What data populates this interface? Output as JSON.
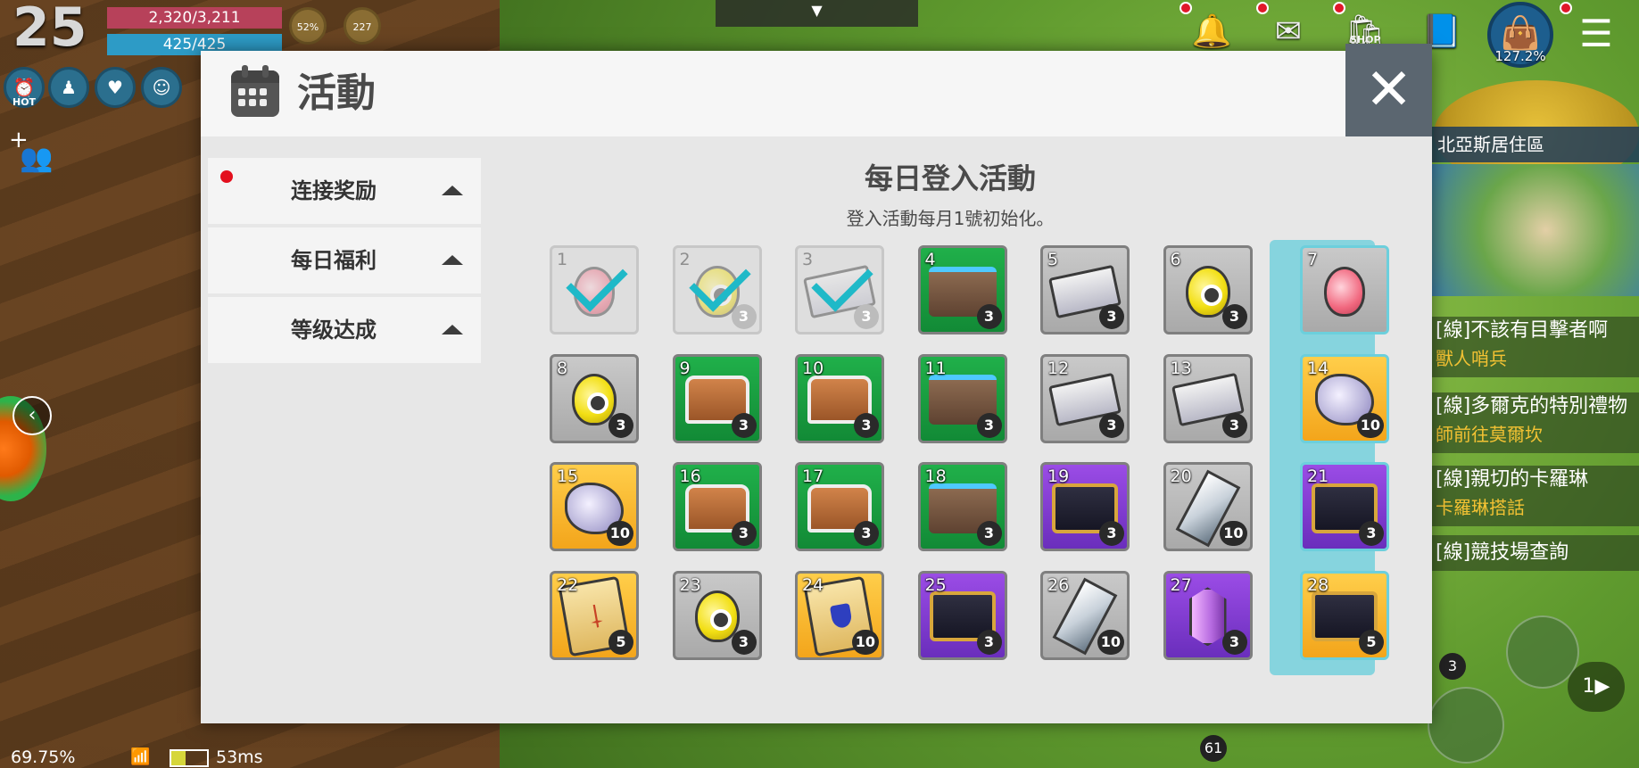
{
  "hud": {
    "level": "25",
    "hp": "2,320/3,211",
    "mp": "425/425",
    "ring_left_pct": "52%",
    "ring_right_val": "227",
    "hot_badge": "HOT",
    "bag_pct": "127.2%",
    "top_icons": [
      "bell-icon",
      "mail-icon",
      "shop-icon",
      "book-icon"
    ],
    "shop_label": "SHOP"
  },
  "status": {
    "battery": "69.75%",
    "ping": "53ms"
  },
  "world": {
    "minimap_label": "北亞斯居住區",
    "quests": [
      {
        "title": "[線]不該有目擊者啊",
        "sub": "獸人哨兵"
      },
      {
        "title": "[線]多爾克的特別禮物",
        "sub": "師前往莫爾坎"
      },
      {
        "title": "[線]親切的卡羅琳",
        "sub": "卡羅琳搭話"
      }
    ],
    "quest_single": "[線]競技場查詢",
    "skill_count_a": "61",
    "skill_count_b": "3",
    "page_next": "1▶"
  },
  "dialog": {
    "title": "活動",
    "close_label": "✕",
    "menu": [
      {
        "label": "连接奖励",
        "has_notification": true
      },
      {
        "label": "每日福利",
        "has_notification": false
      },
      {
        "label": "等级达成",
        "has_notification": false
      }
    ],
    "event_title": "每日登入活動",
    "event_subtitle": "登入活動每月1號初始化。",
    "days": [
      {
        "day": "1",
        "item": "potion-pink",
        "bg": "faded",
        "claimed": true
      },
      {
        "day": "2",
        "item": "potion-yellow",
        "bg": "faded",
        "qty": "3",
        "claimed": true
      },
      {
        "day": "3",
        "item": "ticket",
        "bg": "faded",
        "qty": "3",
        "claimed": true
      },
      {
        "day": "4",
        "item": "chest-green",
        "bg": "green",
        "qty": "3"
      },
      {
        "day": "5",
        "item": "ticket",
        "bg": "gray",
        "qty": "3"
      },
      {
        "day": "6",
        "item": "potion-yellow",
        "bg": "gray",
        "qty": "3"
      },
      {
        "day": "7",
        "item": "potion-pink",
        "bg": "gray",
        "highlight": true
      },
      {
        "day": "8",
        "item": "potion-yellow",
        "bg": "gray",
        "qty": "3"
      },
      {
        "day": "9",
        "item": "chest-wood",
        "bg": "green",
        "qty": "3"
      },
      {
        "day": "10",
        "item": "chest-wood",
        "bg": "green",
        "qty": "3"
      },
      {
        "day": "11",
        "item": "chest-green",
        "bg": "green",
        "qty": "3"
      },
      {
        "day": "12",
        "item": "ticket",
        "bg": "gray",
        "qty": "3"
      },
      {
        "day": "13",
        "item": "ticket",
        "bg": "gray",
        "qty": "3"
      },
      {
        "day": "14",
        "item": "ore",
        "bg": "gold",
        "qty": "10",
        "highlight": true
      },
      {
        "day": "15",
        "item": "ore",
        "bg": "gold",
        "qty": "10"
      },
      {
        "day": "16",
        "item": "chest-wood",
        "bg": "green",
        "qty": "3"
      },
      {
        "day": "17",
        "item": "chest-wood",
        "bg": "green",
        "qty": "3"
      },
      {
        "day": "18",
        "item": "chest-green",
        "bg": "green",
        "qty": "3"
      },
      {
        "day": "19",
        "item": "chest-purple",
        "bg": "purple",
        "qty": "3"
      },
      {
        "day": "20",
        "item": "crystal",
        "bg": "gray",
        "qty": "10"
      },
      {
        "day": "21",
        "item": "chest-purple",
        "bg": "purple",
        "qty": "3",
        "highlight": true
      },
      {
        "day": "22",
        "item": "scroll-sword",
        "bg": "gold",
        "qty": "5"
      },
      {
        "day": "23",
        "item": "potion-yellow",
        "bg": "gray",
        "qty": "3"
      },
      {
        "day": "24",
        "item": "scroll-shield",
        "bg": "gold",
        "qty": "10"
      },
      {
        "day": "25",
        "item": "chest-purple",
        "bg": "purple",
        "qty": "3"
      },
      {
        "day": "26",
        "item": "crystal",
        "bg": "gray",
        "qty": "10"
      },
      {
        "day": "27",
        "item": "gem",
        "bg": "purple",
        "qty": "3"
      },
      {
        "day": "28",
        "item": "chest-purple",
        "bg": "gold",
        "qty": "5",
        "highlight": true
      }
    ]
  }
}
